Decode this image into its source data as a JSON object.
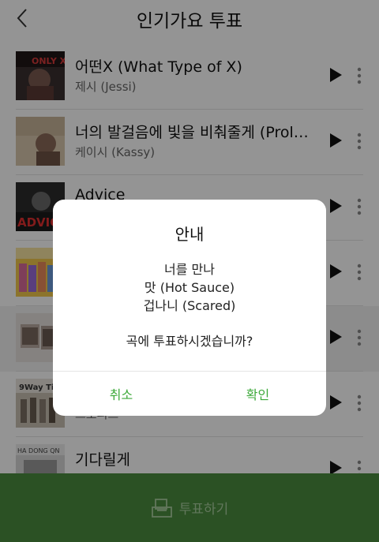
{
  "header": {
    "title": "인기가요 투표"
  },
  "songs": [
    {
      "title": "어떤X (What Type of X)",
      "artist": "제시 (Jessi)"
    },
    {
      "title": "너의 발걸음에 빛을 비춰줄게 (Prologue Ver.)",
      "artist": "케이시 (Kassy)"
    },
    {
      "title": "Advice",
      "artist": ""
    },
    {
      "title": "",
      "artist": ""
    },
    {
      "title": "",
      "artist": ""
    },
    {
      "title": "",
      "artist": "스오피스"
    },
    {
      "title": "기다릴게",
      "artist": ""
    }
  ],
  "dialog": {
    "title": "안내",
    "lines": [
      "너를 만나",
      "맛 (Hot Sauce)",
      "겁나니 (Scared)"
    ],
    "question": "곡에 투표하시겠습니까?",
    "cancel": "취소",
    "confirm": "확인"
  },
  "vote_bar": {
    "label": "투표하기"
  },
  "colors": {
    "accent_green": "#3da93a",
    "vote_bar_bg": "#4a8c3e"
  }
}
